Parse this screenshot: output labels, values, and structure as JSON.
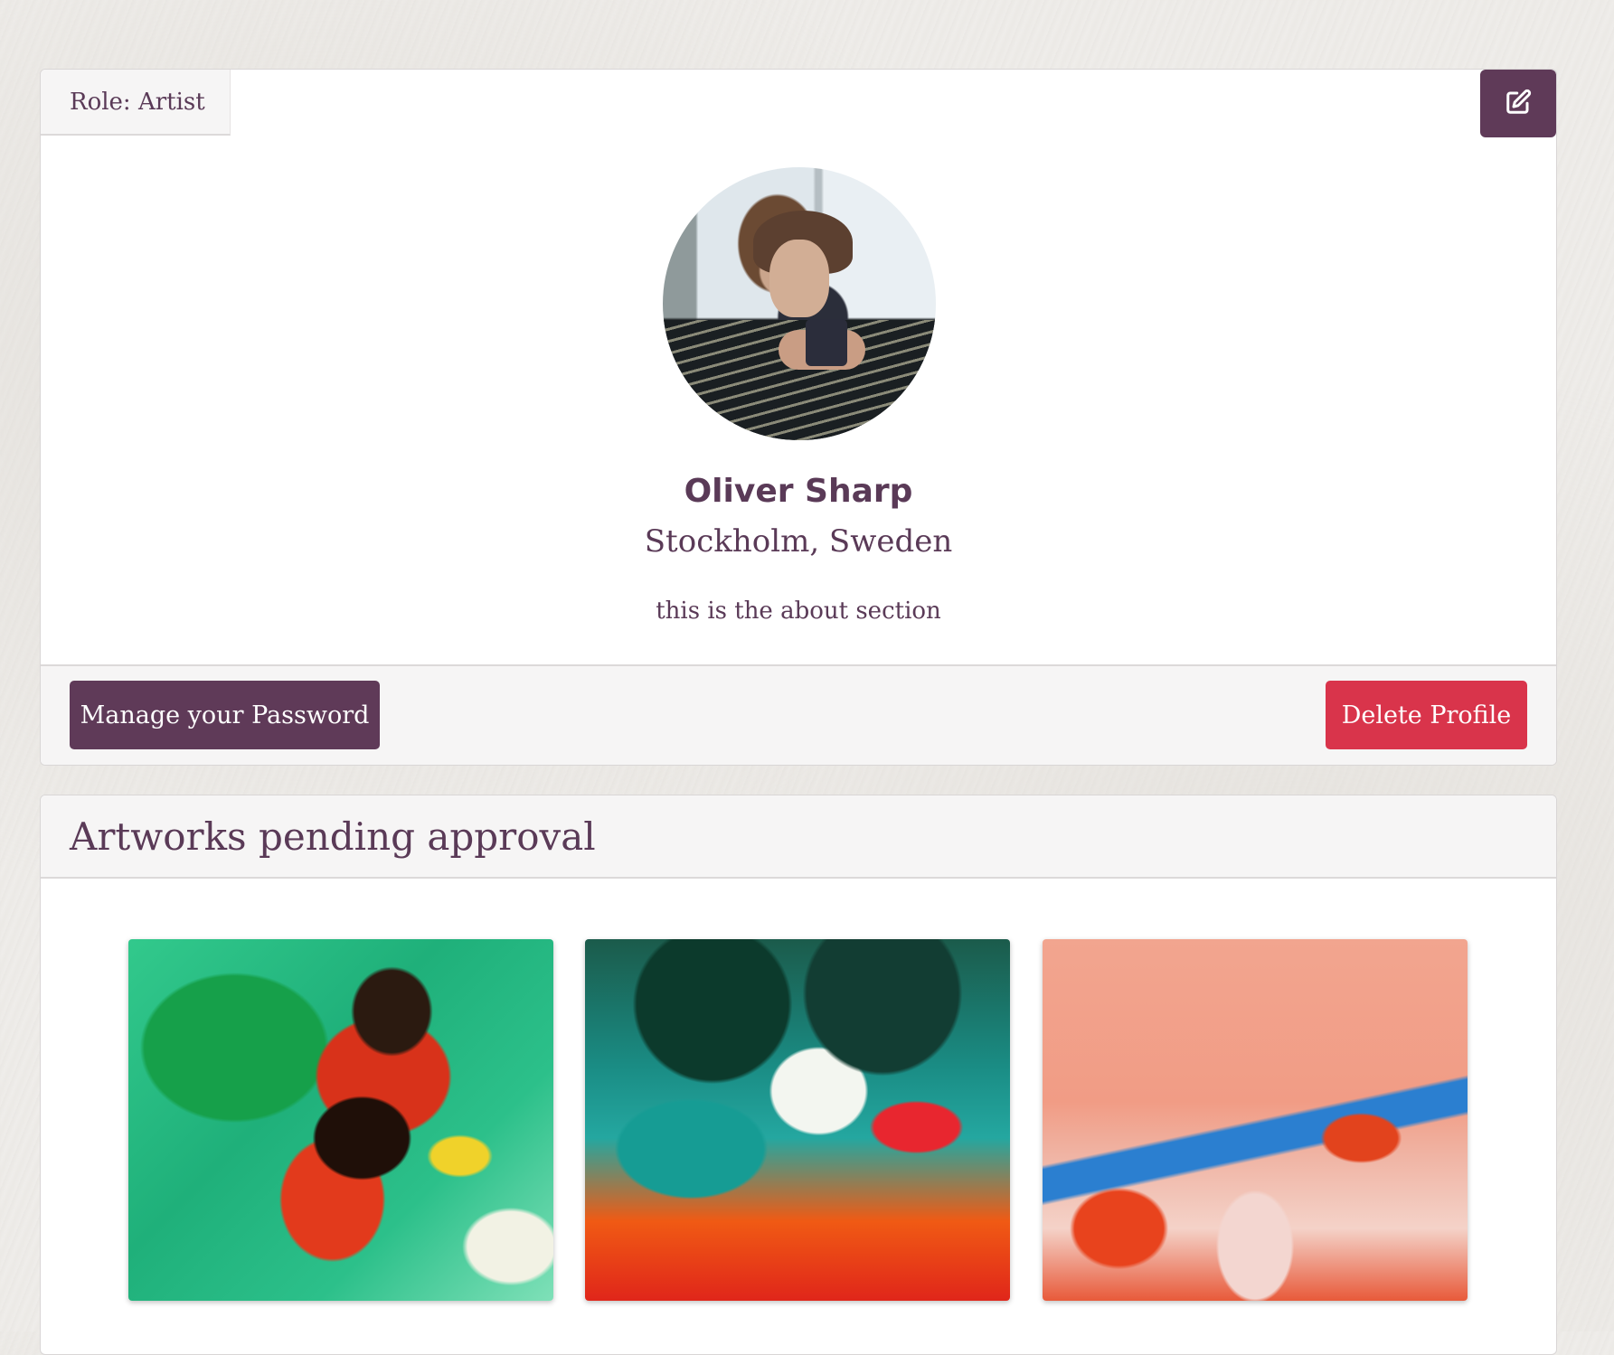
{
  "profile": {
    "role_label": "Role: Artist",
    "name": "Oliver Sharp",
    "location": "Stockholm, Sweden",
    "about": "this is the about section",
    "edit_icon": "edit-icon"
  },
  "actions": {
    "manage_password_label": "Manage your Password",
    "delete_profile_label": "Delete Profile"
  },
  "artworks": {
    "heading": "Artworks pending approval",
    "items": [
      {
        "colors": [
          "#2cc08a",
          "#d8321a",
          "#1f0f08",
          "#f0d22a"
        ]
      },
      {
        "colors": [
          "#1a8c84",
          "#f3f6f0",
          "#e8262f",
          "#f05a14"
        ]
      },
      {
        "colors": [
          "#f19c85",
          "#2b7fd0",
          "#e2431d",
          "#f4d2c8"
        ]
      }
    ]
  },
  "colors": {
    "primary": "#5f3a58",
    "danger": "#d9344b",
    "text": "#5a3a57"
  }
}
